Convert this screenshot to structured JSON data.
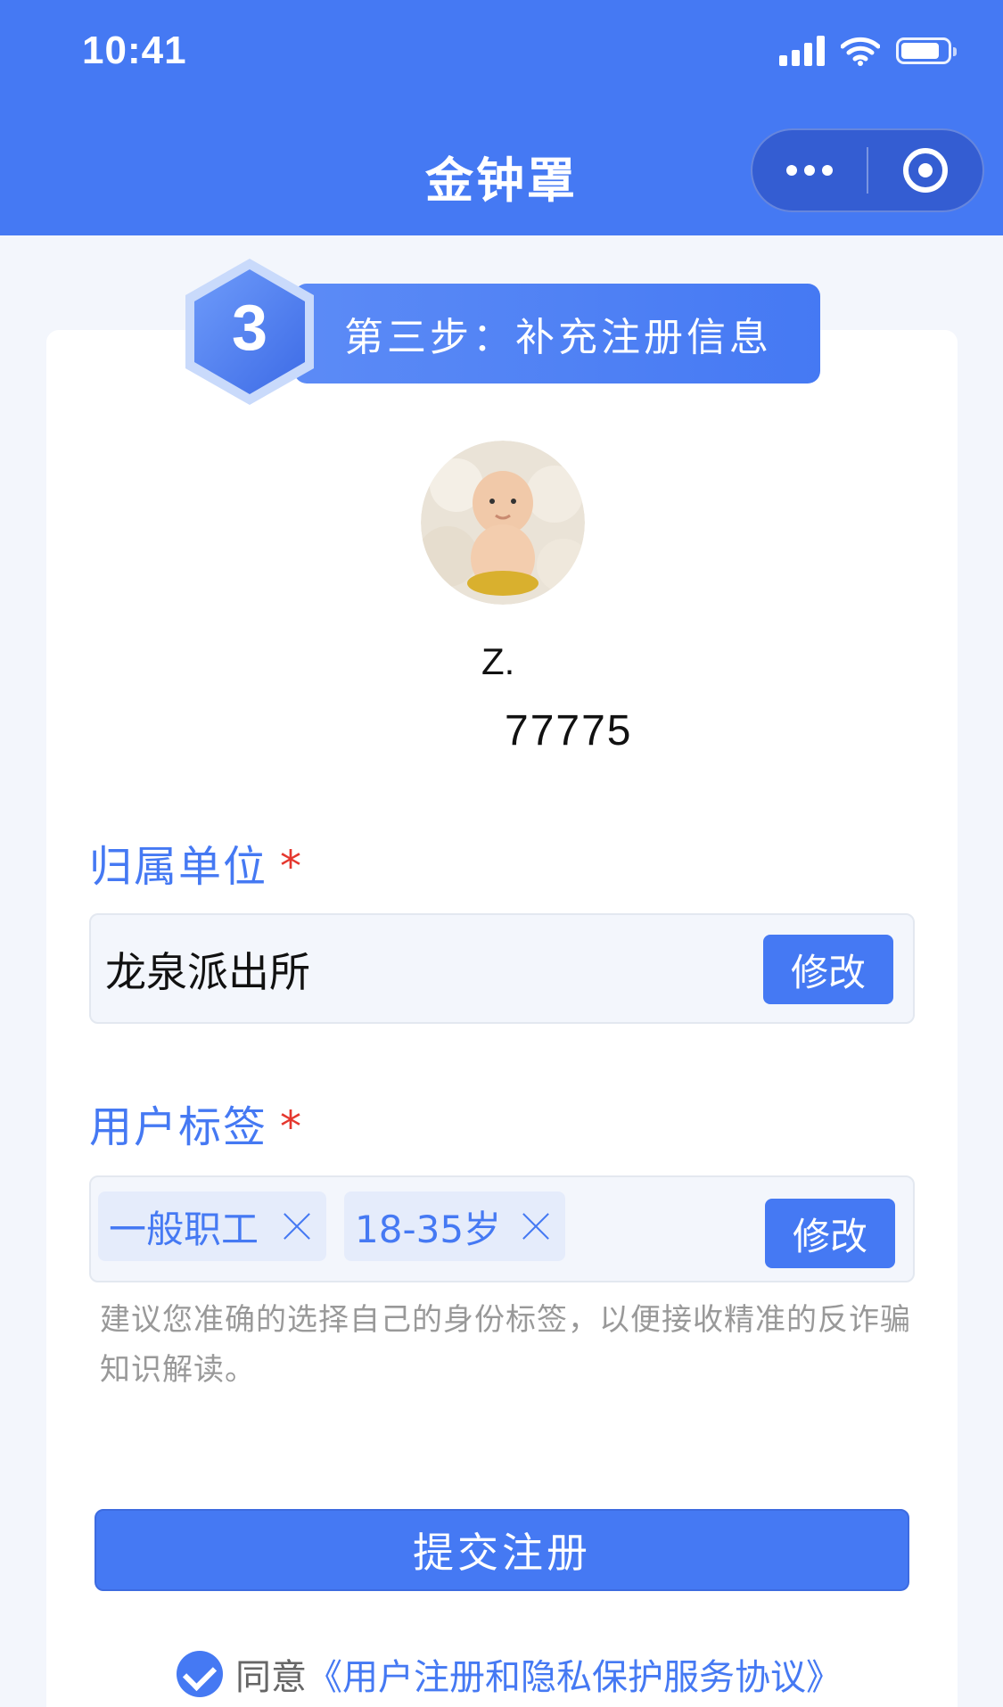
{
  "status_bar": {
    "time": "10:41"
  },
  "nav": {
    "title": "金钟罩"
  },
  "step": {
    "number": "3",
    "label": "第三步：补充注册信息"
  },
  "user": {
    "name": "Z.",
    "id": "77775"
  },
  "unit_field": {
    "label": "归属单位",
    "required_mark": "*",
    "value": "龙泉派出所",
    "edit_label": "修改"
  },
  "tags_field": {
    "label": "用户标签",
    "required_mark": "*",
    "tags": [
      {
        "label": "一般职工"
      },
      {
        "label": "18-35岁"
      }
    ],
    "edit_label": "修改",
    "hint": "建议您准确的选择自己的身份标签，以便接收精准的反诈骗知识解读。"
  },
  "submit": {
    "label": "提交注册"
  },
  "agreement": {
    "prefix": "同意",
    "link": "《用户注册和隐私保护服务协议》"
  },
  "colors": {
    "primary": "#4579F3",
    "required": "#E5372E",
    "hint": "#999999"
  }
}
